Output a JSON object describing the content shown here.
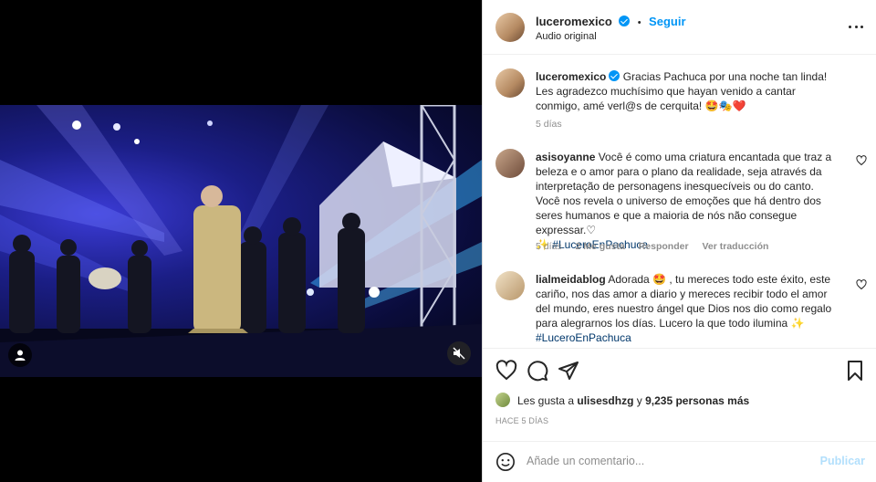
{
  "post": {
    "username": "luceromexico",
    "follow_label": "Seguir",
    "separator": "•",
    "audio": "Audio original"
  },
  "caption": {
    "username": "luceromexico",
    "text": "Gracias Pachuca por una noche tan linda! Les agradezco muchísimo que hayan venido a cantar conmigo, amé verl@s de cerquita! 🤩🎭❤️",
    "time": "5 días"
  },
  "comments": [
    {
      "username": "asisoyanne",
      "text": "Você é como uma criatura encantada que traz a beleza e o amor para o plano da realidade, seja através da interpretação de personagens inesquecíveis ou do canto. Você nos revela o universo de emoções que há dentro dos seres humanos e que a maioria de nós não consegue expressar.♡",
      "hashtag_prefix": "✨",
      "hashtag": "#LuceroEnPachuca",
      "time": "5 días",
      "likes": "2 Me gusta",
      "reply": "Responder",
      "translate": "Ver traducción"
    },
    {
      "username": "lialmeidablog",
      "text": "Adorada 🤩 , tu mereces todo este éxito, este cariño, nos das amor a diario y mereces recibir todo el amor del mundo, eres nuestro ángel que Dios nos dio como regalo para alegrarnos los días. Lucero la que todo ilumina ✨",
      "hashtag": "#LuceroEnPachuca"
    }
  ],
  "likes": {
    "prefix": "Les gusta a",
    "user": "ulisesdhzg",
    "middle": "y",
    "count": "9,235 personas más"
  },
  "ago": "HACE 5 DÍAS",
  "add_comment": {
    "placeholder": "Añade un comentario...",
    "publish": "Publicar"
  },
  "icons": [
    "user-tag-icon",
    "mute-icon",
    "more-icon",
    "heart-icon",
    "comment-icon",
    "share-icon",
    "bookmark-icon",
    "emoji-icon",
    "verified-icon"
  ],
  "colors": {
    "accent": "#0095f6",
    "link": "#00376b",
    "muted": "#8e8e8e",
    "publish_disabled": "#b2dffc"
  }
}
